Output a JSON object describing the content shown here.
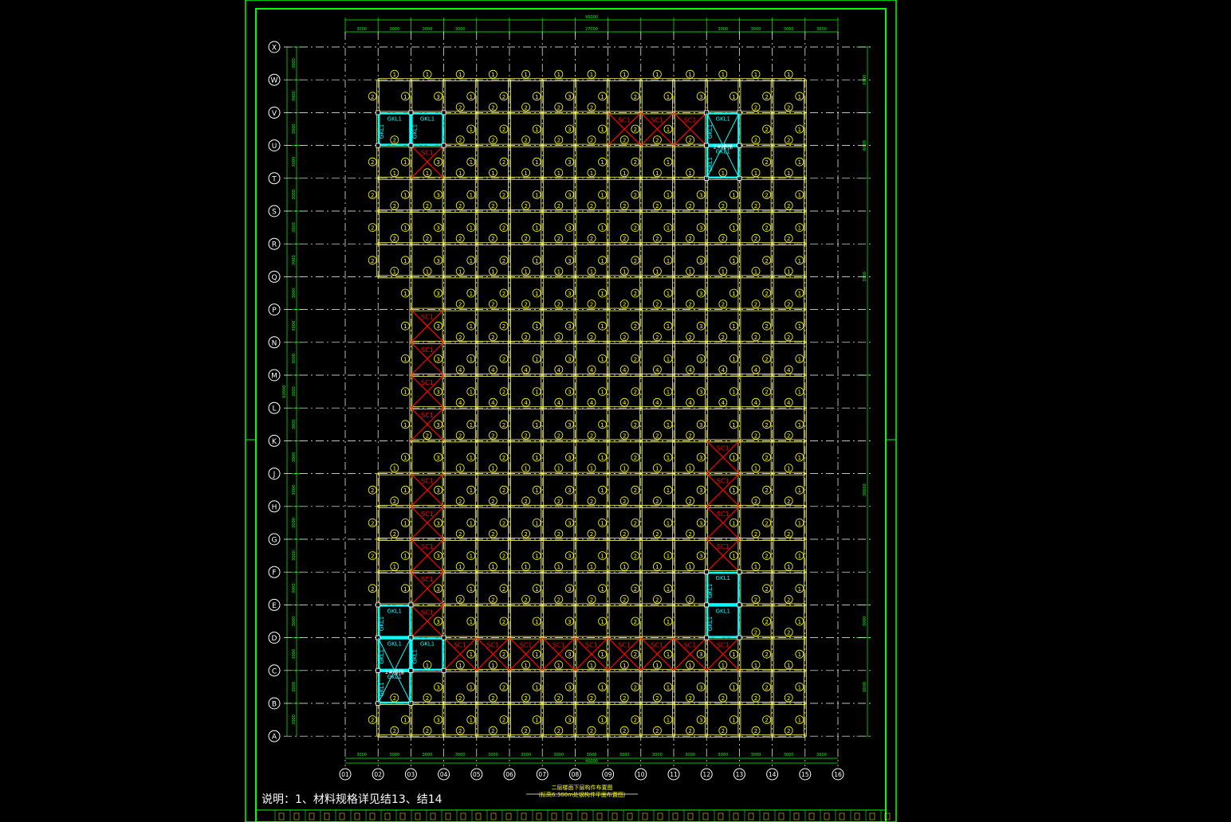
{
  "drawing": {
    "note": "说明：1、材料规格详见结13、结14",
    "title": "二层楼面下层构件布置图",
    "subtitle": "（标高6.300m处钢构件平面布置图）",
    "row_axes": [
      "X",
      "W",
      "V",
      "U",
      "T",
      "S",
      "R",
      "Q",
      "P",
      "N",
      "M",
      "L",
      "K",
      "J",
      "H",
      "G",
      "F",
      "E",
      "D",
      "C",
      "B",
      "A"
    ],
    "col_axes": [
      "01",
      "02",
      "03",
      "04",
      "05",
      "06",
      "07",
      "08",
      "09",
      "10",
      "11",
      "12",
      "13",
      "14",
      "15",
      "16"
    ],
    "col_spacing_label": "3000",
    "row_spacing_label": "3000",
    "overall_width_label": "45000",
    "middle_width_label": "27000",
    "right_dim_labels": [
      "6000",
      "6000",
      "3000",
      "30000",
      "3000",
      "6000"
    ],
    "left_total_label": "63000",
    "brace_label": "SC1",
    "frame_beam_label": "GKL1",
    "stair_labels": [
      "1#楼梯",
      "2#楼梯"
    ],
    "beam_marks": [
      "1",
      "2",
      "3",
      "4"
    ],
    "colors": {
      "frame": "#00ff00",
      "grid": "#ffffff",
      "beam": "#ffff66",
      "brace": "#ff0000",
      "stair": "#00ffff",
      "mark": "#ffff00"
    }
  }
}
